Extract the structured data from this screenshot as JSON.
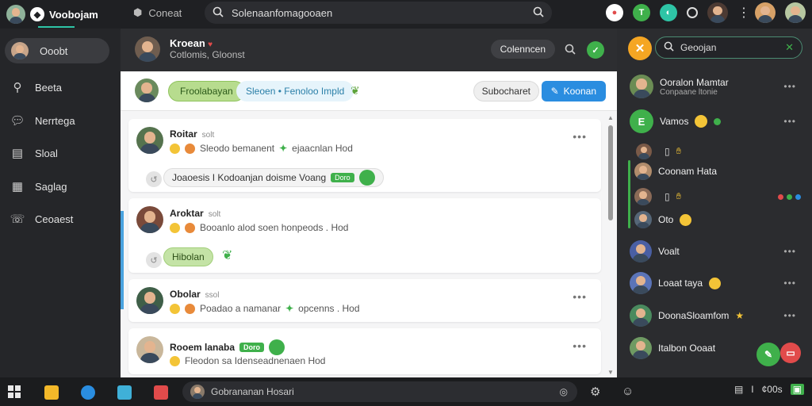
{
  "app": {
    "title": "Voobojam"
  },
  "top": {
    "contacts_label": "Coneat",
    "search_text": "Solenaanfomagooaen"
  },
  "sidebar": {
    "items": [
      {
        "label": "Ooobt"
      },
      {
        "label": "Beeta"
      },
      {
        "label": "Nerrtega"
      },
      {
        "label": "Sloal"
      },
      {
        "label": "Saglag"
      },
      {
        "label": "Ceoaest"
      }
    ]
  },
  "chat_header": {
    "name": "Kroean",
    "status": "Cotlomis, Gloonst",
    "action_label": "Colenncen"
  },
  "toolbar": {
    "chip_primary": "Froolabayan",
    "chip_secondary": "Sleoen • Fenoloo Impld",
    "secondary_button": "Subocharet",
    "primary_button": "Koonan"
  },
  "messages": [
    {
      "name": "Roitar",
      "meta": "solt",
      "text": "Sleodo bemanent",
      "text_tail": "ejaacnlan Hod",
      "reply": "Joaoesis I Kodoanjan doisme Voang",
      "reply_tag": "Doro"
    },
    {
      "name": "Aroktar",
      "meta": "solt",
      "text": "Booanlo alod soen honpeods . Hod",
      "reply": "Hibolan"
    },
    {
      "name": "Obolar",
      "meta": "ssol",
      "text": "Poadao a namanar",
      "text_tail": "opcenns . Hod"
    },
    {
      "name": "Rooem lanaba",
      "name_tag": "Doro",
      "text": "Fleodon sa Idenseadnenaen Hod"
    }
  ],
  "right_panel": {
    "search_text": "Geoojan",
    "items": [
      {
        "name": "Ooralon Mamtar",
        "sub": "Conpaane ltonie"
      },
      {
        "name": "Vamos"
      },
      {
        "name": ""
      },
      {
        "name": "Coonam Hata"
      },
      {
        "name": ""
      },
      {
        "name": "Oto"
      },
      {
        "name": "Voalt"
      },
      {
        "name": "Loaat taya"
      },
      {
        "name": "DoonaSloamfom"
      },
      {
        "name": "Italbon Ooaat"
      }
    ]
  },
  "taskbar": {
    "search_text": "Gobrananan Hosari",
    "clock": "¢00s"
  },
  "colors": {
    "accent_teal": "#2ec4a6",
    "accent_green": "#3fb04b",
    "accent_blue": "#2a8de0",
    "accent_orange": "#f5a623"
  }
}
